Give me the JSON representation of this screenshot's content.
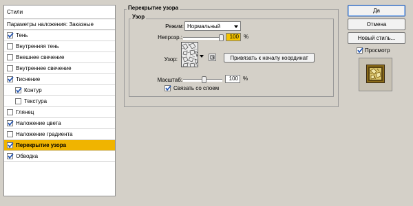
{
  "styles_panel": {
    "header": "Стили",
    "items": [
      {
        "label": "Параметры наложения: Заказные",
        "checkbox": false,
        "checked": false,
        "selected": false,
        "indent": false
      },
      {
        "label": "Тень",
        "checkbox": true,
        "checked": true,
        "selected": false,
        "indent": false
      },
      {
        "label": "Внутренняя тень",
        "checkbox": true,
        "checked": false,
        "selected": false,
        "indent": false
      },
      {
        "label": "Внешнее свечение",
        "checkbox": true,
        "checked": false,
        "selected": false,
        "indent": false
      },
      {
        "label": "Внутреннее свечение",
        "checkbox": true,
        "checked": false,
        "selected": false,
        "indent": false
      },
      {
        "label": "Тиснение",
        "checkbox": true,
        "checked": true,
        "selected": false,
        "indent": false
      },
      {
        "label": "Контур",
        "checkbox": true,
        "checked": true,
        "selected": false,
        "indent": true
      },
      {
        "label": "Текстура",
        "checkbox": true,
        "checked": false,
        "selected": false,
        "indent": true
      },
      {
        "label": "Глянец",
        "checkbox": true,
        "checked": false,
        "selected": false,
        "indent": false
      },
      {
        "label": "Наложение цвета",
        "checkbox": true,
        "checked": true,
        "selected": false,
        "indent": false
      },
      {
        "label": "Наложение градиента",
        "checkbox": true,
        "checked": false,
        "selected": false,
        "indent": false
      },
      {
        "label": "Перекрытие узора",
        "checkbox": true,
        "checked": true,
        "selected": true,
        "indent": false
      },
      {
        "label": "Обводка",
        "checkbox": true,
        "checked": true,
        "selected": false,
        "indent": false
      }
    ]
  },
  "pattern_overlay": {
    "title": "Перекрытие узора",
    "group_title": "Узор",
    "mode_label": "Режим:",
    "mode_value": "Нормальный",
    "opacity_label": "Непрозр.:",
    "opacity_value": "100",
    "opacity_unit": "%",
    "opacity_level": 1.0,
    "pattern_label": "Узор:",
    "snap_button": "Привязать к началу координат",
    "scale_label": "Масштаб:",
    "scale_value": "100",
    "scale_unit": "%",
    "link_label": "Связать со слоем",
    "link_checked": true
  },
  "buttons": {
    "ok": "Да",
    "cancel": "Отмена",
    "new_style": "Новый стиль...",
    "preview_label": "Просмотр",
    "preview_checked": true
  },
  "colors": {
    "dialog_bg": "#d4d0c8",
    "selected_row": "#f0b400",
    "highlight_field": "#f5c400"
  }
}
